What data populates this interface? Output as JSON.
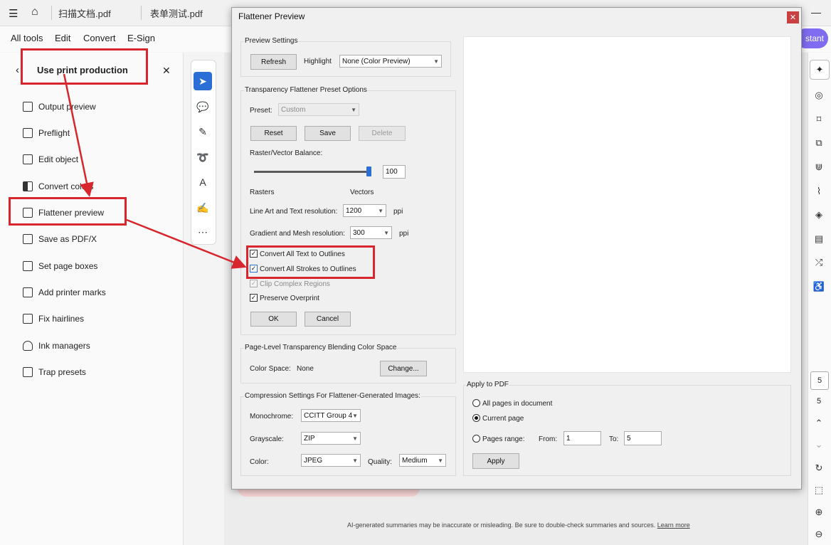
{
  "tabs": [
    {
      "label": "扫描文档.pdf"
    },
    {
      "label": "表单测试.pdf"
    }
  ],
  "menu": {
    "items": [
      "All tools",
      "Edit",
      "Convert",
      "E-Sign"
    ],
    "assistant_fragment": "stant"
  },
  "panel": {
    "title": "Use print production",
    "items": [
      "Output preview",
      "Preflight",
      "Edit object",
      "Convert colors",
      "Flattener preview",
      "Save as PDF/X",
      "Set page boxes",
      "Add printer marks",
      "Fix hairlines",
      "Ink managers",
      "Trap presets"
    ]
  },
  "dialog": {
    "title": "Flattener Preview",
    "preview_settings": {
      "title": "Preview Settings",
      "refresh": "Refresh",
      "highlight_label": "Highlight",
      "highlight_value": "None (Color Preview)"
    },
    "preset_options": {
      "title": "Transparency Flattener Preset Options",
      "preset_label": "Preset:",
      "preset_value": "Custom",
      "reset": "Reset",
      "save": "Save",
      "delete": "Delete",
      "balance_label": "Raster/Vector Balance:",
      "balance_value": "100",
      "balance_level": 1.0,
      "rasters_label": "Rasters",
      "vectors_label": "Vectors",
      "lineart_label": "Line Art and Text resolution:",
      "lineart_value": "1200",
      "gradient_label": "Gradient and Mesh resolution:",
      "gradient_value": "300",
      "unit": "ppi",
      "convert_text": "Convert All Text to Outlines",
      "convert_strokes": "Convert All Strokes to Outlines",
      "clip_complex": "Clip Complex Regions",
      "preserve_overprint": "Preserve Overprint",
      "ok": "OK",
      "cancel": "Cancel"
    },
    "blending": {
      "title": "Page-Level Transparency Blending Color Space",
      "label": "Color Space:",
      "value": "None",
      "change": "Change..."
    },
    "compression": {
      "title": "Compression Settings For Flattener-Generated Images:",
      "mono_label": "Monochrome:",
      "mono_value": "CCITT Group 4",
      "gray_label": "Grayscale:",
      "gray_value": "ZIP",
      "color_label": "Color:",
      "color_value": "JPEG",
      "quality_label": "Quality:",
      "quality_value": "Medium"
    },
    "apply": {
      "title": "Apply to PDF",
      "all_pages": "All pages in document",
      "current_page": "Current page",
      "pages_range": "Pages range:",
      "from_label": "From:",
      "from_value": "1",
      "to_label": "To:",
      "to_value": "5",
      "apply_button": "Apply"
    }
  },
  "page_nav": {
    "page_input": "5",
    "page_total": "5"
  },
  "footer": {
    "disclaimer": "AI-generated summaries may be inaccurate or misleading. Be sure to double-check summaries and sources.",
    "learn_more": "Learn more"
  },
  "colors": {
    "annotation_red": "#d7262d",
    "accent_blue": "#2b6fd6"
  }
}
